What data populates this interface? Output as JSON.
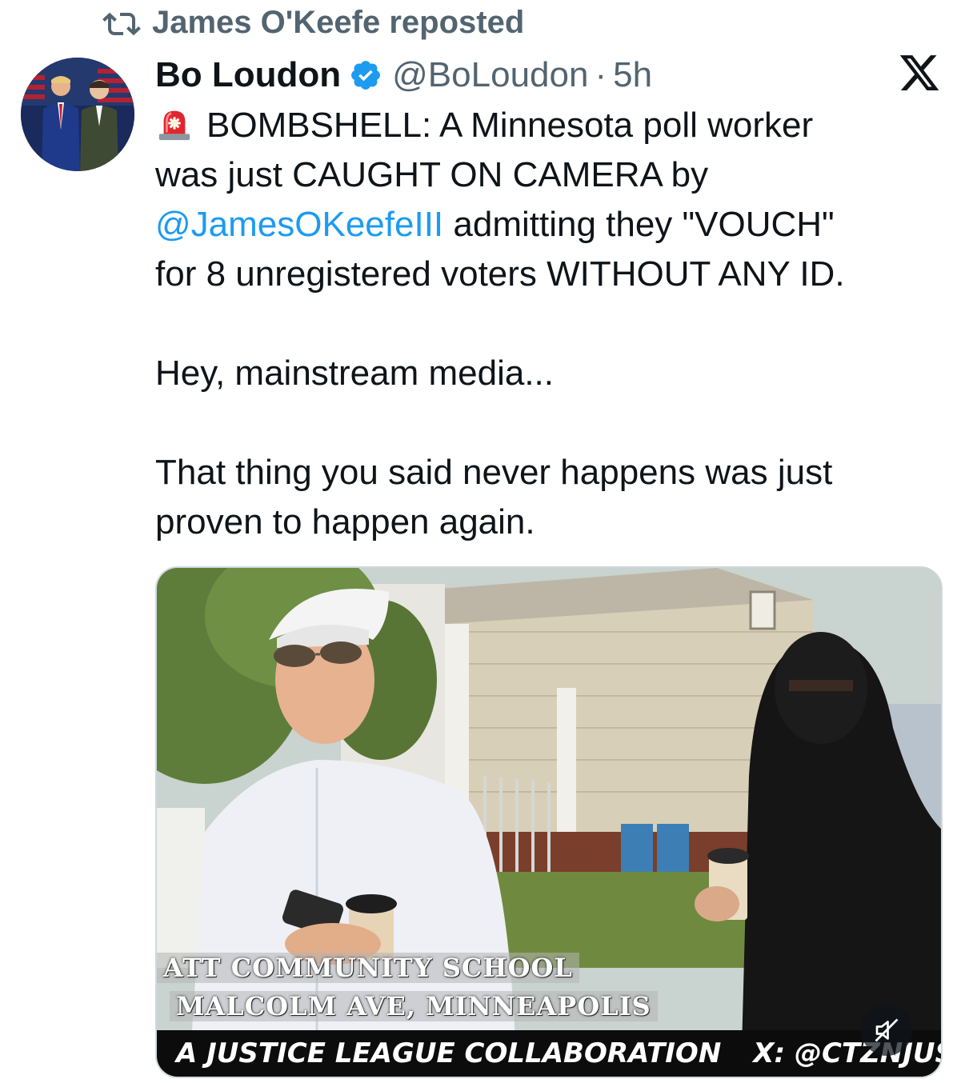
{
  "repost": {
    "label": "James O'Keefe reposted",
    "icon": "repost-icon"
  },
  "author": {
    "name": "Bo Loudon",
    "handle": "@BoLoudon",
    "separator": "·",
    "time": "5h",
    "verified": true,
    "verified_color": "#1d9bf0"
  },
  "platform_icon": "x-logo-icon",
  "tweet": {
    "line1_prefix": "BOMBSHELL: A Minnesota poll worker",
    "line2": "was just CAUGHT ON CAMERA by",
    "mention": "@JamesOKeefeIII",
    "line3_suffix": " admitting they \"VOUCH\"",
    "line4": "for 8 unregistered voters WITHOUT ANY ID.",
    "para2": "Hey, mainstream media...",
    "para3_line1": "That thing you said never happens was just",
    "para3_line2": "proven to happen again.",
    "emoji": "siren-emoji",
    "link_color": "#1d9bf0"
  },
  "media": {
    "overlay_line1": "ATT COMMUNITY SCHOOL",
    "overlay_line2": "MALCOLM AVE, MINNEAPOLIS",
    "banner_left": "A JUSTICE LEAGUE COLLABORATION",
    "banner_right": "X: @CTZNJUSTICE",
    "mute_icon": "muted-speaker-icon"
  },
  "colors": {
    "text_primary": "#0f1419",
    "text_secondary": "#536471",
    "accent": "#1d9bf0"
  }
}
